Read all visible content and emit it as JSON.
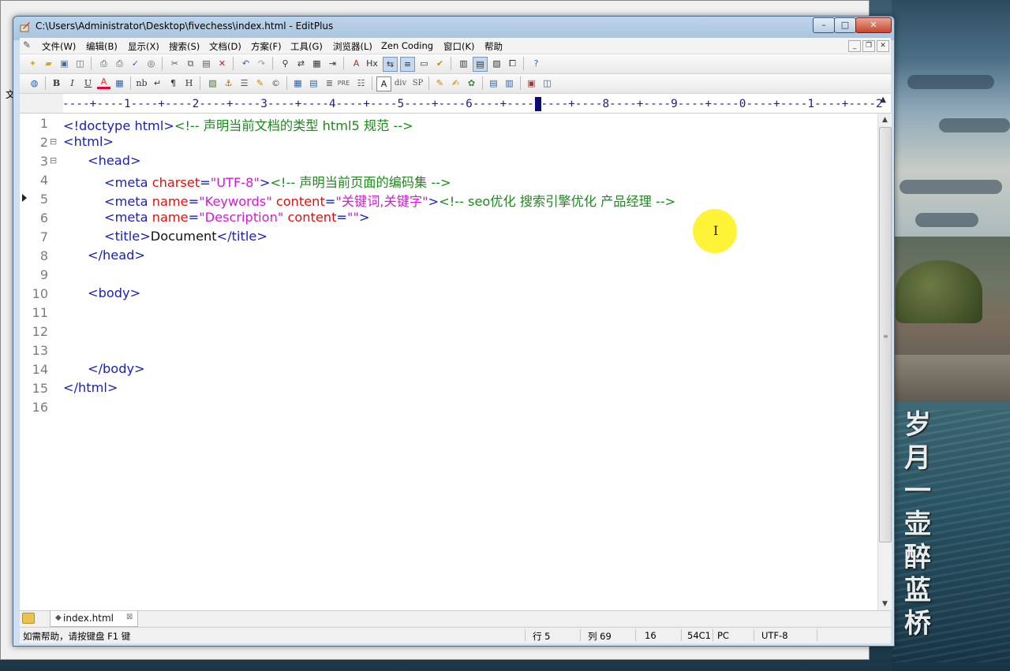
{
  "window": {
    "title": "C:\\Users\\Administrator\\Desktop\\fivechess\\index.html - EditPlus",
    "min": "–",
    "max": "□",
    "close": "✕"
  },
  "background_window": {
    "label": "文"
  },
  "menubar": {
    "items": [
      "文件(W)",
      "编辑(B)",
      "显示(X)",
      "搜索(S)",
      "文档(D)",
      "方案(F)",
      "工具(G)",
      "浏览器(L)",
      "Zen Coding",
      "窗口(K)",
      "帮助"
    ]
  },
  "toolbar2_labels": {
    "bold": "B",
    "italic": "I",
    "underline": "U",
    "font_color": "A",
    "nbsp": "nb",
    "br": "↵",
    "para": "¶",
    "hr": "H",
    "pre": "PRE",
    "div": "div",
    "sp": "SP"
  },
  "ruler": {
    "text": "----+----1----+----2----+----3----+----4----+----5----+----6----+----7----+----8----+----9----+----0----+----1----+----2"
  },
  "editor": {
    "line_numbers": [
      "1",
      "2",
      "3",
      "4",
      "5",
      "6",
      "7",
      "8",
      "9",
      "10",
      "11",
      "12",
      "13",
      "14",
      "15",
      "16"
    ],
    "lines": {
      "l1_tag": "<!doctype html>",
      "l1_comment": "<!-- 声明当前文档的类型 html5 规范 -->",
      "l2_tag": "<html>",
      "l3_tag": "<head>",
      "l4_open": "<meta ",
      "l4_attr": "charset",
      "l4_eq": "=",
      "l4_val": "\"UTF-8\"",
      "l4_close": ">",
      "l4_comment": "<!-- 声明当前页面的编码集 -->",
      "l5_open": "<meta ",
      "l5_attr1": "name",
      "l5_eq1": "=",
      "l5_val1": "\"Keywords\"",
      "l5_attr2": " content",
      "l5_eq2": "=",
      "l5_val2": "\"关键词,关键字\"",
      "l5_close": ">",
      "l5_comment": "<!-- seo优化 搜索引擎优化 产品经理 -->",
      "l6_open": "<meta ",
      "l6_attr1": "name",
      "l6_eq1": "=",
      "l6_val1": "\"Description\"",
      "l6_attr2": " content",
      "l6_eq2": "=",
      "l6_val2": "\"\"",
      "l6_close": ">",
      "l7_open": "<title>",
      "l7_text": "Document",
      "l7_close": "</title>",
      "l8_tag": "</head>",
      "l10_tag": "<body>",
      "l14_tag": "</body>",
      "l15_tag": "</html>"
    },
    "fold_markers": [
      "⊟",
      "⊟"
    ]
  },
  "tabs": [
    {
      "label": "index.html"
    }
  ],
  "statusbar": {
    "help": "如需帮助，请按键盘 F1 键",
    "row": "行 5",
    "col": "列 69",
    "count": "16",
    "code": "54C1",
    "line_ending": "PC",
    "encoding": "UTF-8"
  },
  "calligraphy": [
    "岁",
    "月",
    "一",
    "壶",
    "醉",
    "蓝",
    "桥"
  ],
  "colors": {
    "tag": "#1a21b8",
    "attribute": "#e01010",
    "value": "#d41ad4",
    "comment": "#1b8a1b",
    "cursor_highlight": "#fff000"
  }
}
